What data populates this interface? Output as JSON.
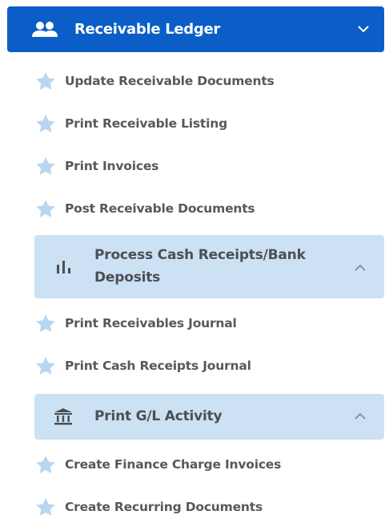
{
  "header": {
    "title": "Receivable Ledger",
    "icon": "people-icon",
    "chevron": "chevron-down-icon",
    "background": "#0b5ec7"
  },
  "items_top": [
    {
      "label": "Update Receivable Documents",
      "icon": "star-icon"
    },
    {
      "label": "Print Receivable Listing",
      "icon": "star-icon"
    },
    {
      "label": "Print Invoices",
      "icon": "star-icon"
    },
    {
      "label": "Post Receivable Documents",
      "icon": "star-icon"
    }
  ],
  "group_cash": {
    "label_line1": "Process Cash Receipts/Bank",
    "label_line2": "Deposits",
    "icon": "bar-chart-icon",
    "chevron": "chevron-up-icon",
    "background": "#cde1f4"
  },
  "items_cash": [
    {
      "label": "Print Receivables Journal",
      "icon": "star-icon"
    },
    {
      "label": "Print Cash Receipts Journal",
      "icon": "star-icon"
    }
  ],
  "group_gl": {
    "label": "Print G/L Activity",
    "icon": "bank-icon",
    "chevron": "chevron-up-icon"
  },
  "items_gl": [
    {
      "label": "Create Finance Charge Invoices",
      "icon": "star-icon"
    },
    {
      "label": "Create Recurring Documents",
      "icon": "star-icon"
    }
  ],
  "colors": {
    "star": "#b9d6f1",
    "text": "#55595f",
    "group_text": "#4b4f55"
  }
}
